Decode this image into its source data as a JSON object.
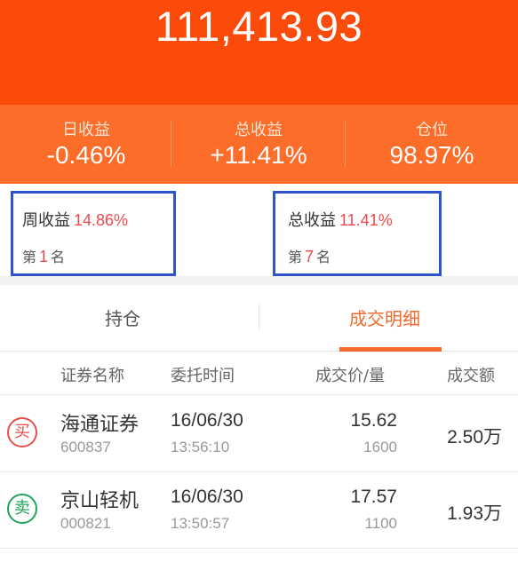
{
  "header": {
    "total_asset": "111,413.93",
    "stats": [
      {
        "label": "日收益",
        "value": "-0.46%"
      },
      {
        "label": "总收益",
        "value": "+11.41%"
      },
      {
        "label": "仓位",
        "value": "98.97%"
      }
    ]
  },
  "ranks": {
    "week": {
      "label": "周收益",
      "value": "14.86%",
      "rank_prefix": "第",
      "rank": "1",
      "rank_suffix": "名"
    },
    "total": {
      "label": "总收益",
      "value": "11.41%",
      "rank_prefix": "第",
      "rank": "7",
      "rank_suffix": "名"
    }
  },
  "tabs": {
    "holdings": "持仓",
    "deals": "成交明细",
    "active": "deals"
  },
  "table": {
    "headers": [
      "证券名称",
      "委托时间",
      "成交价/量",
      "成交额"
    ],
    "rows": [
      {
        "side": "买",
        "side_type": "buy",
        "name": "海通证券",
        "code": "600837",
        "date": "16/06/30",
        "time": "13:56:10",
        "price": "15.62",
        "qty": "1600",
        "amount": "2.50",
        "amount_unit": "万"
      },
      {
        "side": "卖",
        "side_type": "sell",
        "name": "京山轻机",
        "code": "000821",
        "date": "16/06/30",
        "time": "13:50:57",
        "price": "17.57",
        "qty": "1100",
        "amount": "1.93",
        "amount_unit": "万"
      }
    ]
  },
  "colors": {
    "header": "#fa4b0a",
    "accent": "#f26a2b",
    "positive": "#f0494b",
    "buy": "#e84e4e",
    "sell": "#1fa65a",
    "highlight_box": "#2f54c9"
  }
}
